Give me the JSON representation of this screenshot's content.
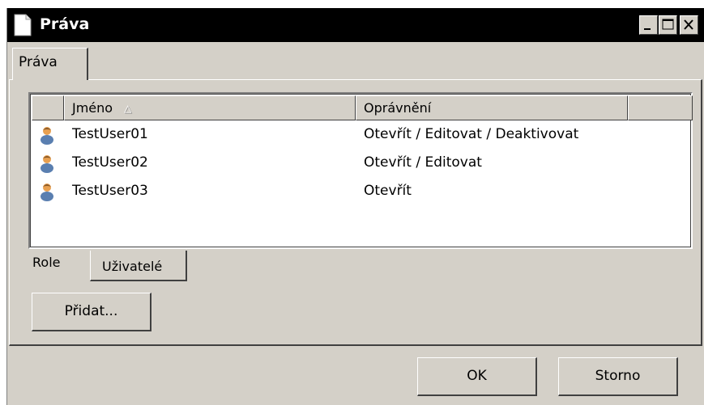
{
  "window": {
    "title": "Práva",
    "icon": "document-icon"
  },
  "titlebar_buttons": [
    "minimize",
    "maximize",
    "close"
  ],
  "outer_tabs": [
    {
      "label": "Práva",
      "active": true
    }
  ],
  "list": {
    "columns": [
      {
        "label": "Jméno",
        "sorted": "ascending"
      },
      {
        "label": "Oprávnění"
      },
      {
        "label": ""
      }
    ],
    "rows": [
      {
        "icon": "user-icon",
        "name": "TestUser01",
        "permissions": "Otevřít / Editovat / Deaktivovat"
      },
      {
        "icon": "user-icon",
        "name": "TestUser02",
        "permissions": "Otevřít / Editovat"
      },
      {
        "icon": "user-icon",
        "name": "TestUser03",
        "permissions": "Otevřít"
      }
    ]
  },
  "inner_tabs": [
    {
      "label": "Role",
      "active": false
    },
    {
      "label": "Uživatelé",
      "active": true
    }
  ],
  "buttons": {
    "add": "Přidat...",
    "ok": "OK",
    "cancel": "Storno"
  },
  "sort_arrow": "△"
}
